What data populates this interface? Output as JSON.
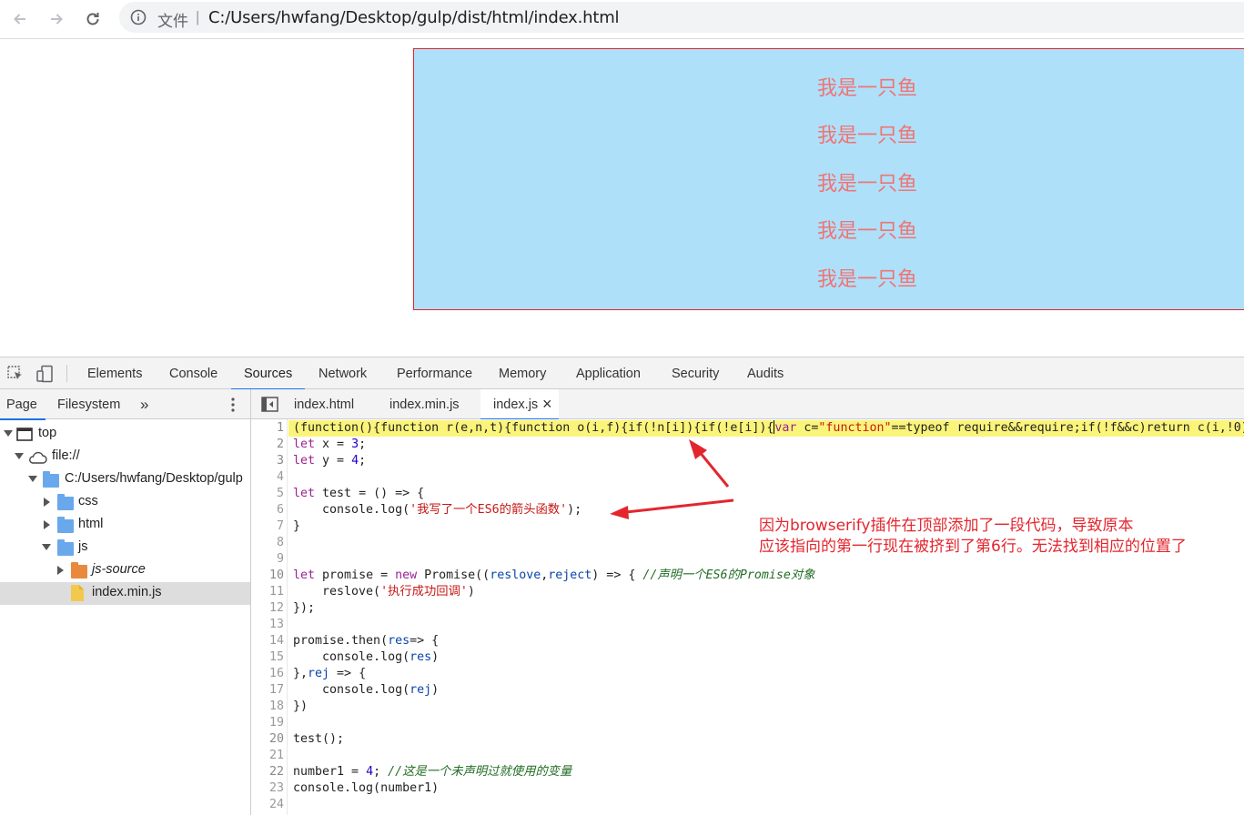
{
  "browser": {
    "address_label": "文件",
    "address_separator": "|",
    "url": "C:/Users/hwfang/Desktop/gulp/dist/html/index.html"
  },
  "page": {
    "lines": [
      "我是一只鱼",
      "我是一只鱼",
      "我是一只鱼",
      "我是一只鱼",
      "我是一只鱼"
    ],
    "box_background": "#aee0fa",
    "box_border": "#e3262e",
    "text_color": "#f07474"
  },
  "devtools": {
    "tabs": [
      "Elements",
      "Console",
      "Sources",
      "Network",
      "Performance",
      "Memory",
      "Application",
      "Security",
      "Audits"
    ],
    "active_tab": "Sources",
    "navigator": {
      "tabs": [
        "Page",
        "Filesystem"
      ],
      "more": "»",
      "tree": [
        {
          "label": "top",
          "icon": "frame-icon"
        },
        {
          "label": "file://",
          "icon": "cloud-icon"
        },
        {
          "label": "C:/Users/hwfang/Desktop/gulp",
          "icon": "folder-icon"
        },
        {
          "label": "css",
          "icon": "folder-icon"
        },
        {
          "label": "html",
          "icon": "folder-icon"
        },
        {
          "label": "js",
          "icon": "folder-icon"
        },
        {
          "label": "js-source",
          "icon": "folder-icon"
        },
        {
          "label": "index.min.js",
          "icon": "file-icon"
        }
      ]
    },
    "editor_tabs": [
      "index.html",
      "index.min.js",
      "index.js"
    ],
    "active_editor_tab": "index.js",
    "close_glyph": "×"
  },
  "code": {
    "line_numbers": [
      "1",
      "2",
      "3",
      "4",
      "5",
      "6",
      "7",
      "8",
      "9",
      "10",
      "11",
      "12",
      "13",
      "14",
      "15",
      "16",
      "17",
      "18",
      "19",
      "20",
      "21",
      "22",
      "23",
      "24"
    ]
  },
  "annotation": {
    "line1": "因为browserify插件在顶部添加了一段代码，导致原本",
    "line2": "应该指向的第一行现在被挤到了第6行。无法找到相应的位置了",
    "color": "#e3262e"
  },
  "colors": {
    "accent": "#1a73e8",
    "highlight_line": "#fbf47a"
  }
}
